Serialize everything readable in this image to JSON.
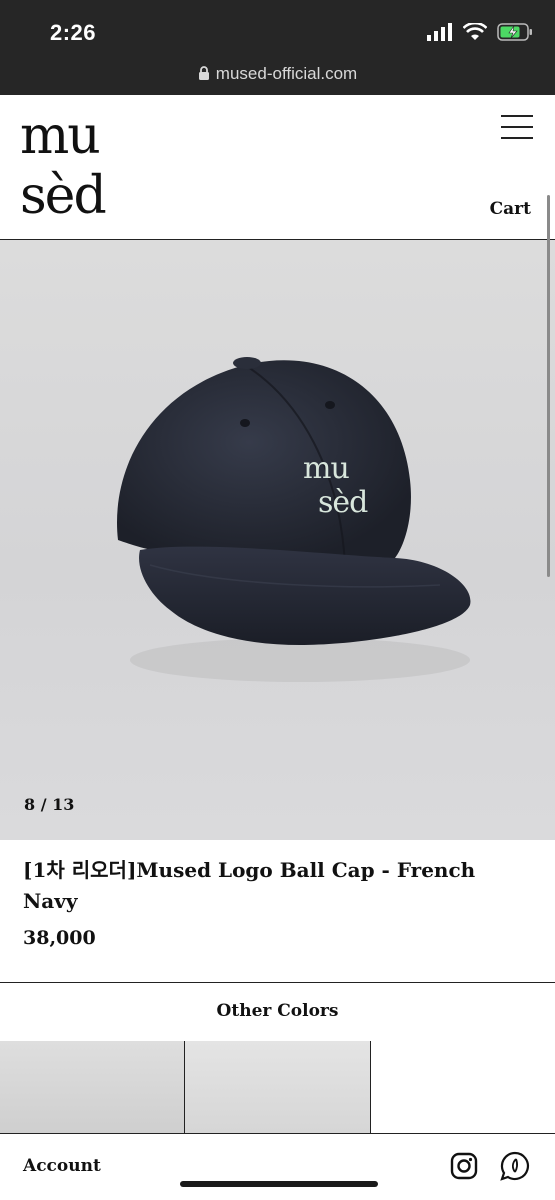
{
  "status_bar": {
    "time": "2:26",
    "url": "mused-official.com"
  },
  "header": {
    "logo_top": "mu",
    "logo_bottom": "sèd",
    "cart_label": "Cart"
  },
  "product": {
    "image_alt": "navy ball cap",
    "image_counter": "8 / 13",
    "title": "[1차 리오더]Mused Logo Ball Cap - French Navy",
    "price": "38,000"
  },
  "other_colors": {
    "label": "Other Colors"
  },
  "footer": {
    "account_label": "Account"
  },
  "colors": {
    "cap_navy": "#262a36",
    "status_bar_bg": "#262626",
    "battery_green": "#4cd964"
  }
}
